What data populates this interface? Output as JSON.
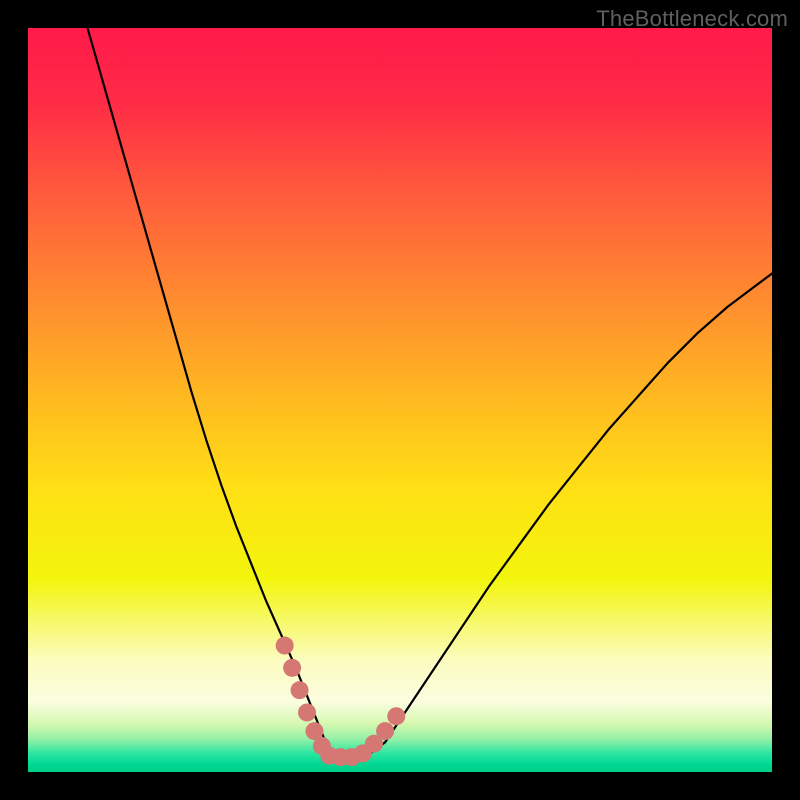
{
  "watermark": "TheBottleneck.com",
  "colors": {
    "frame": "#000000",
    "gradient_stops": [
      {
        "offset": 0.0,
        "color": "#ff1a4a"
      },
      {
        "offset": 0.1,
        "color": "#ff2b46"
      },
      {
        "offset": 0.22,
        "color": "#ff5a3c"
      },
      {
        "offset": 0.36,
        "color": "#ff8a30"
      },
      {
        "offset": 0.5,
        "color": "#ffba20"
      },
      {
        "offset": 0.62,
        "color": "#ffe015"
      },
      {
        "offset": 0.74,
        "color": "#f3f50c"
      },
      {
        "offset": 0.85,
        "color": "#fbfcbf"
      },
      {
        "offset": 0.905,
        "color": "#fbfde0"
      },
      {
        "offset": 0.935,
        "color": "#d6f8b0"
      },
      {
        "offset": 0.955,
        "color": "#97f0a7"
      },
      {
        "offset": 0.975,
        "color": "#2be6a1"
      },
      {
        "offset": 0.99,
        "color": "#00d892"
      },
      {
        "offset": 1.0,
        "color": "#00cd8a"
      }
    ],
    "curve": "#000000",
    "marker_fill": "#d57874",
    "marker_stroke": "#d57874"
  },
  "chart_data": {
    "type": "line",
    "title": "",
    "xlabel": "",
    "ylabel": "",
    "xlim": [
      0,
      100
    ],
    "ylim": [
      0,
      100
    ],
    "grid": false,
    "legend": false,
    "series": [
      {
        "name": "bottleneck-curve",
        "x": [
          8,
          10,
          12,
          14,
          16,
          18,
          20,
          22,
          24,
          26,
          28,
          30,
          32,
          34,
          36,
          37,
          38,
          39,
          40,
          41,
          42,
          43,
          44,
          46,
          48,
          50,
          54,
          58,
          62,
          66,
          70,
          74,
          78,
          82,
          86,
          90,
          94,
          98,
          100
        ],
        "y": [
          100,
          93,
          86,
          79,
          72,
          65,
          58,
          51,
          44.5,
          38.5,
          33,
          28,
          23,
          18.5,
          14,
          11.5,
          9,
          6.5,
          4,
          2.5,
          2,
          2,
          2,
          2.5,
          4,
          7,
          13,
          19,
          25,
          30.5,
          36,
          41,
          46,
          50.5,
          55,
          59,
          62.5,
          65.5,
          67
        ]
      }
    ],
    "markers": {
      "name": "highlight-band",
      "x": [
        34.5,
        35.5,
        36.5,
        37.5,
        38.5,
        39.5,
        40.5,
        42.0,
        43.5,
        45.0,
        46.5,
        48.0,
        49.5
      ],
      "y": [
        17.0,
        14.0,
        11.0,
        8.0,
        5.5,
        3.5,
        2.2,
        2.0,
        2.0,
        2.5,
        3.8,
        5.5,
        7.5
      ]
    }
  }
}
